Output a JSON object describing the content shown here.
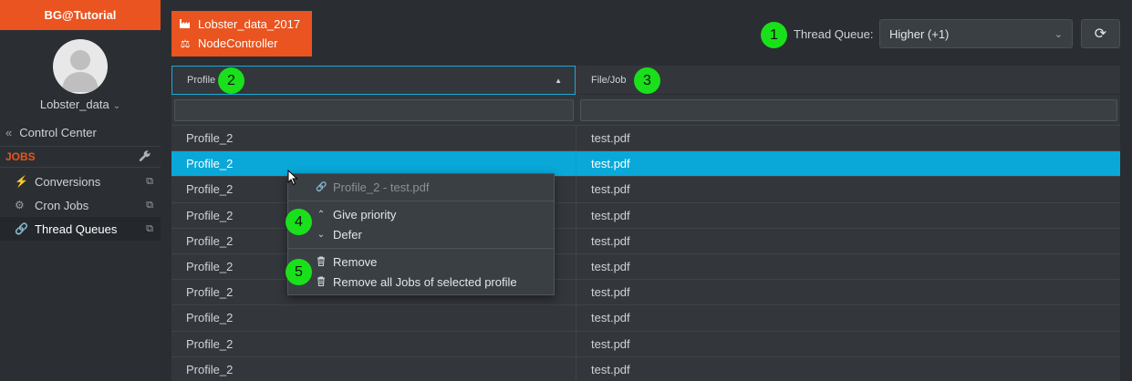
{
  "sidebar": {
    "brand": "BG@Tutorial",
    "user_name": "Lobster_data",
    "control_center": "Control Center",
    "section_label": "JOBS",
    "items": [
      {
        "label": "Conversions",
        "icon": "bolt-icon"
      },
      {
        "label": "Cron Jobs",
        "icon": "cron-icon"
      },
      {
        "label": "Thread Queues",
        "icon": "link-icon"
      }
    ]
  },
  "context_box": {
    "line1": "Lobster_data_2017",
    "line2": "NodeController"
  },
  "thread_queue": {
    "label": "Thread Queue:",
    "value": "Higher (+1)"
  },
  "table": {
    "col_profile": "Profile",
    "col_file": "File/Job",
    "rows": [
      {
        "profile": "Profile_2",
        "file": "test.pdf"
      },
      {
        "profile": "Profile_2",
        "file": "test.pdf"
      },
      {
        "profile": "Profile_2",
        "file": "test.pdf"
      },
      {
        "profile": "Profile_2",
        "file": "test.pdf"
      },
      {
        "profile": "Profile_2",
        "file": "test.pdf"
      },
      {
        "profile": "Profile_2",
        "file": "test.pdf"
      },
      {
        "profile": "Profile_2",
        "file": "test.pdf"
      },
      {
        "profile": "Profile_2",
        "file": "test.pdf"
      },
      {
        "profile": "Profile_2",
        "file": "test.pdf"
      },
      {
        "profile": "Profile_2",
        "file": "test.pdf"
      }
    ],
    "selected_row": 1
  },
  "context_menu": {
    "title": "Profile_2 - test.pdf",
    "give_priority": "Give priority",
    "defer": "Defer",
    "remove": "Remove",
    "remove_all": "Remove all Jobs of selected profile"
  },
  "markers": [
    "1",
    "2",
    "3",
    "4",
    "5"
  ],
  "colors": {
    "accent": "#e95420",
    "selection": "#09a8d9",
    "marker": "#19e01a",
    "background": "#2a2e33"
  }
}
